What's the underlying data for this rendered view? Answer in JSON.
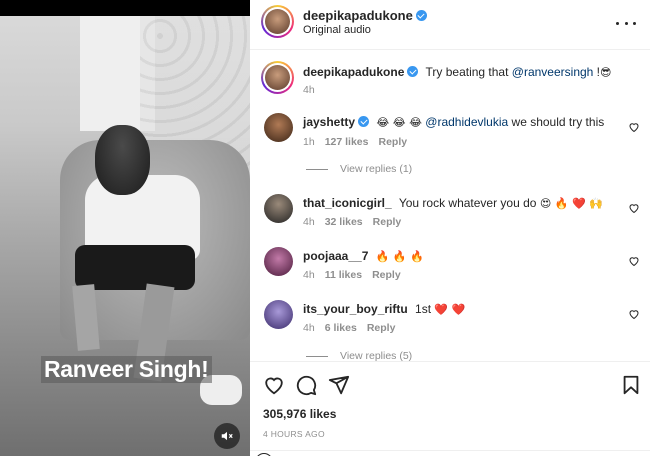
{
  "video": {
    "overlay_text": "Ranveer Singh!"
  },
  "header": {
    "username": "deepikapadukone",
    "audio": "Original audio"
  },
  "caption": {
    "username": "deepikapadukone",
    "text_prefix": "Try beating that ",
    "mention": "@ranveersingh",
    "text_suffix": " !",
    "emoji": "😎",
    "time": "4h"
  },
  "comments": [
    {
      "username": "jayshetty",
      "verified": true,
      "emojis": "😂 😂 😂",
      "mention": "@radhidevlukia",
      "text": " we should try this",
      "time": "1h",
      "likes": "127 likes",
      "reply": "Reply",
      "view_replies": "View replies (1)",
      "avatar_color": "#7a4a2a"
    },
    {
      "username": "that_iconicgirl_",
      "text": "You rock whatever you do",
      "emojis": "😍 🔥 ❤️ 🙌",
      "time": "4h",
      "likes": "32 likes",
      "reply": "Reply",
      "avatar_color": "#3a3a3a"
    },
    {
      "username": "poojaaa__7",
      "emojis": "🔥 🔥 🔥",
      "time": "4h",
      "likes": "11 likes",
      "reply": "Reply",
      "avatar_color": "#8a3a6a"
    },
    {
      "username": "its_your_boy_riftu",
      "text": "1st",
      "emojis": "❤️ ❤️",
      "time": "4h",
      "likes": "6 likes",
      "reply": "Reply",
      "view_replies": "View replies (5)",
      "avatar_color": "#6a5aa0"
    }
  ],
  "post": {
    "likes": "305,976 likes",
    "time": "4 HOURS AGO"
  },
  "icons": {
    "like": "heart-icon",
    "comment": "comment-icon",
    "share": "send-icon",
    "save": "bookmark-icon",
    "mute": "muted-speaker-icon",
    "more": "more-horizontal-icon"
  },
  "colors": {
    "verified": "#3897f0",
    "mention": "#00376b",
    "secondary_text": "#8e8e8e"
  }
}
